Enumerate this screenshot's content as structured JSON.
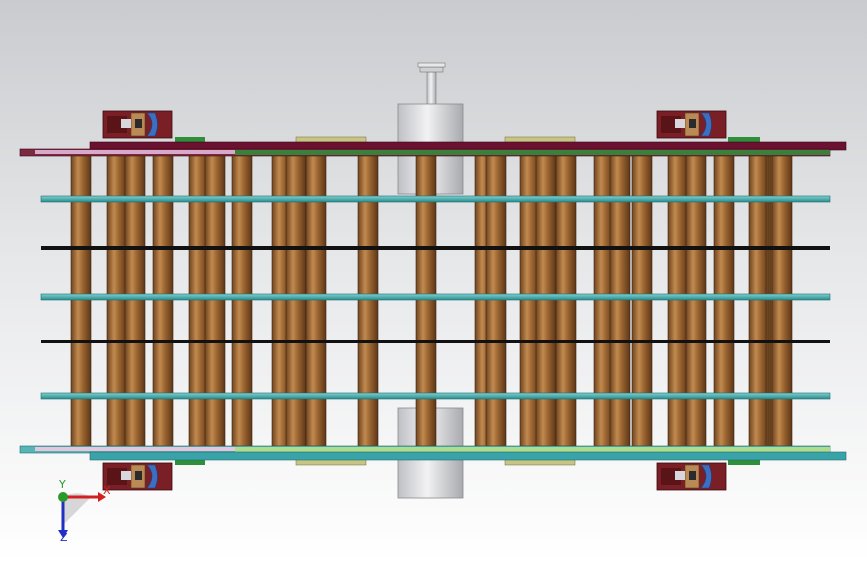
{
  "viewport": {
    "background_top": "#c9cbce",
    "background_bottom": "#ffffff"
  },
  "colors": {
    "roller_wood": "#8b5a2b",
    "roller_highlight": "#c18a4f",
    "rail_teal": "#3fa0a0",
    "rail_black": "#111111",
    "top_frame_maroon": "#6a1230",
    "bottom_frame_teal": "#3aa3a8",
    "drum_steel": "#d8d8dc",
    "bearing_block": "#7a1f25",
    "bearing_blue": "#3c6fc0",
    "pad_olive": "#b8b872",
    "pad_green": "#2f8f3a"
  },
  "model": {
    "roller_count": 28,
    "teal_rail_count": 3,
    "black_rail_count": 2,
    "bearing_housing_count": 4,
    "drum_count": 2
  },
  "triad": {
    "x_label": "X",
    "y_label": "Y",
    "z_label": "Z",
    "icon": "coordinate-triad-icon"
  }
}
